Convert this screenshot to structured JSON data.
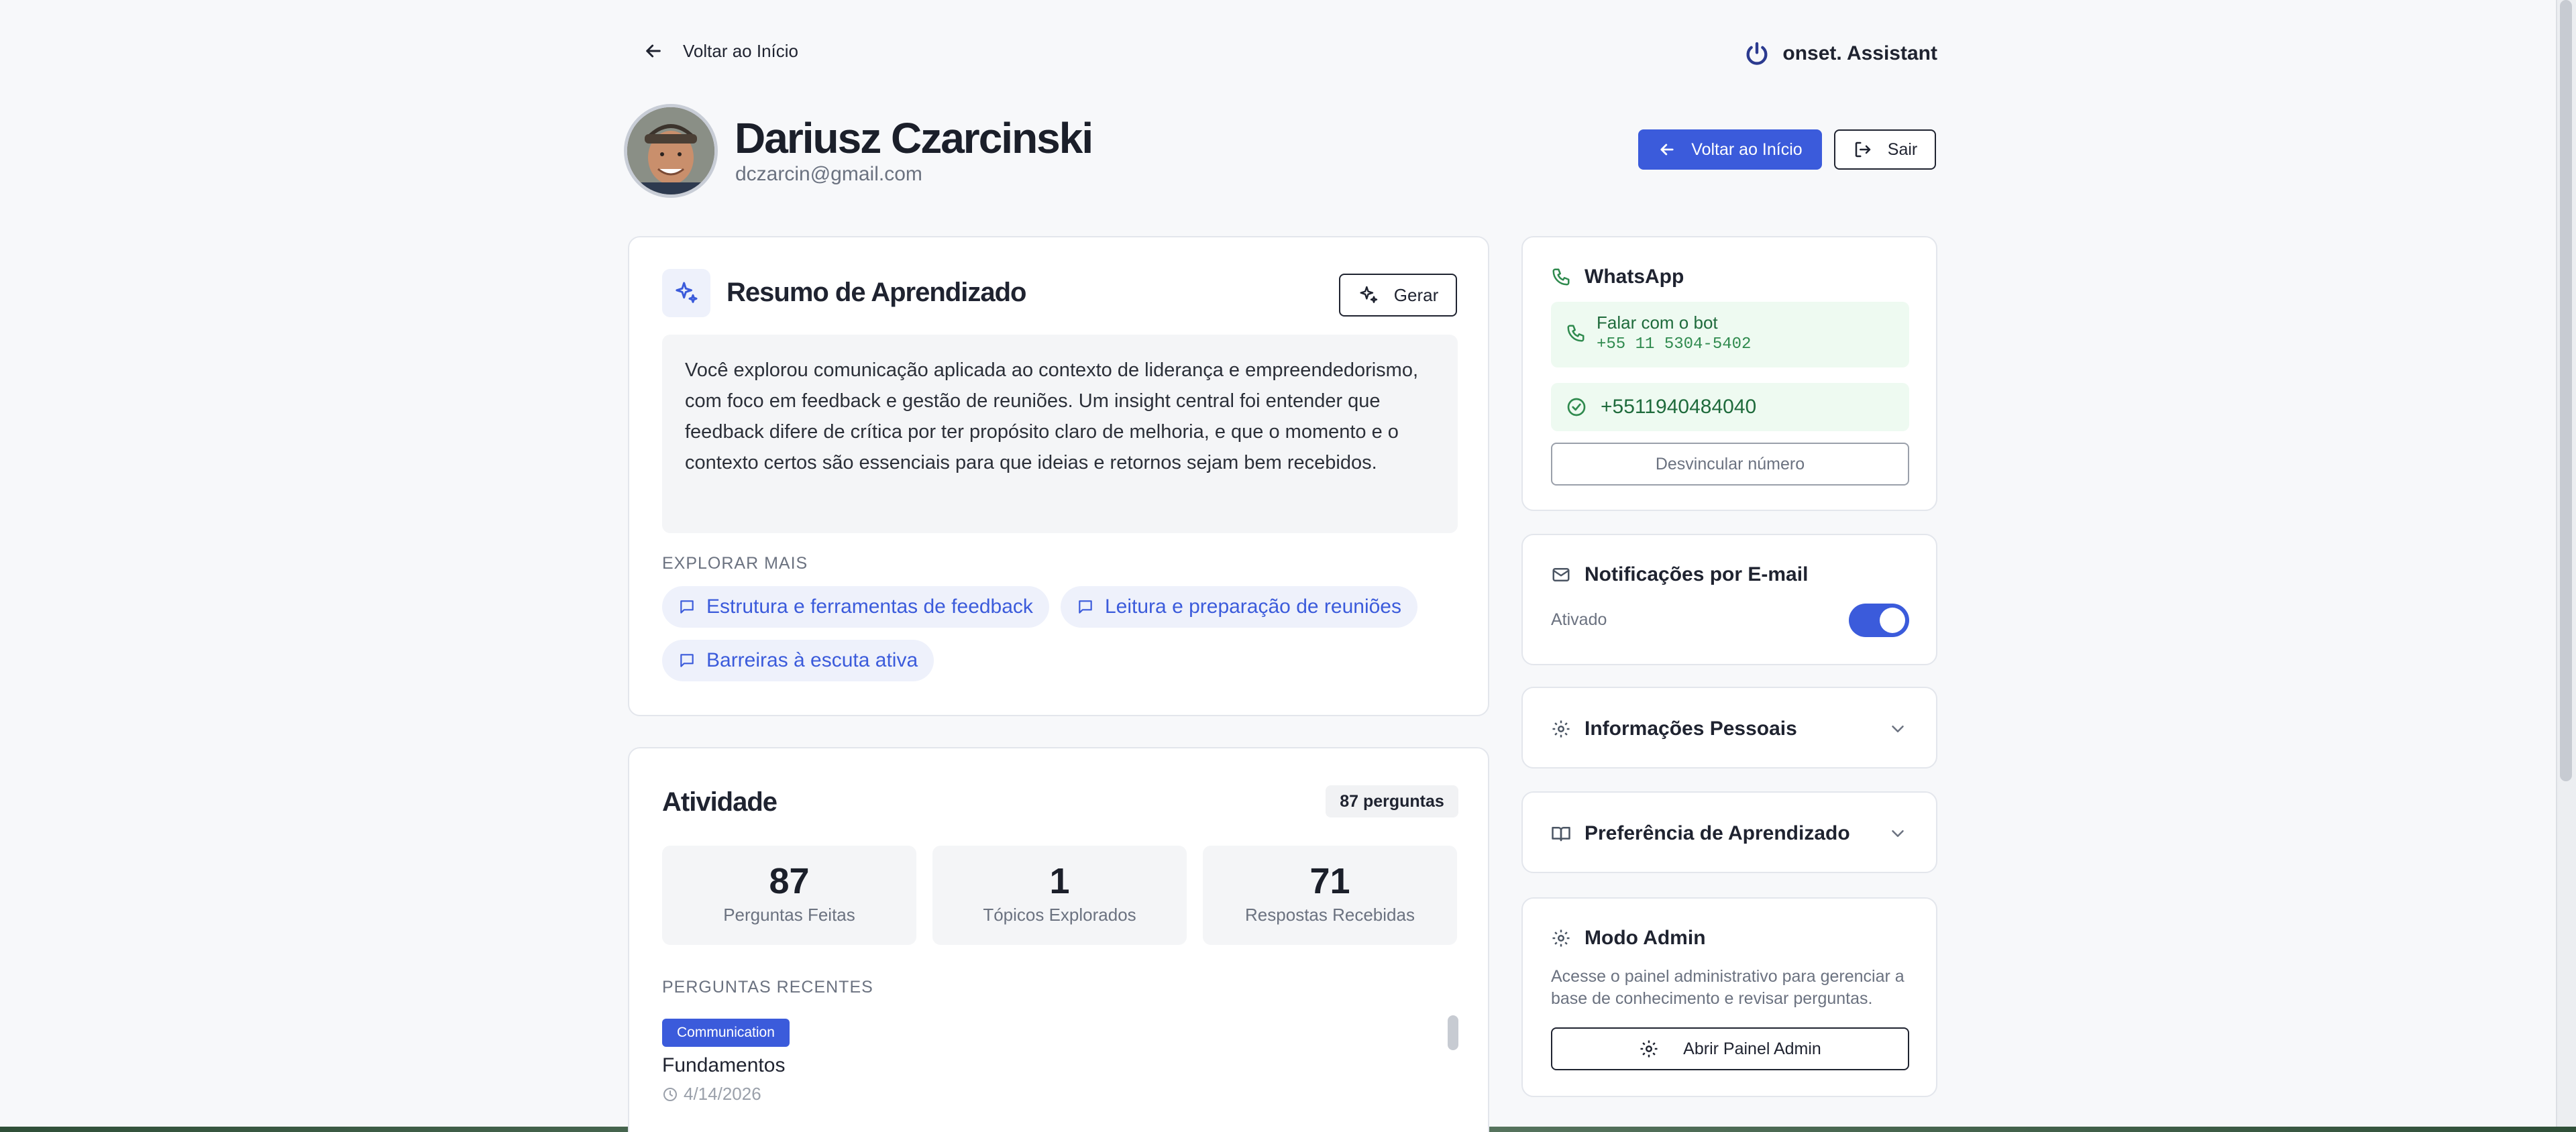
{
  "topbar": {
    "back_label": "Voltar ao Início",
    "brand": "onset. Assistant"
  },
  "profile": {
    "name": "Dariusz Czarcinski",
    "email": "dczarcin@gmail.com",
    "back_button": "Voltar ao Início",
    "logout_button": "Sair"
  },
  "summary": {
    "title": "Resumo de Aprendizado",
    "generate_button": "Gerar",
    "text": "Você explorou comunicação aplicada ao contexto de liderança e empreendedorismo, com foco em feedback e gestão de reuniões. Um insight central foi entender que feedback difere de crítica por ter propósito claro de melhoria, e que o momento e o contexto certos são essenciais para que ideias e retornos sejam bem recebidos.",
    "explore_label": "EXPLORAR MAIS",
    "topics": [
      "Estrutura e ferramentas de feedback",
      "Leitura e preparação de reuniões",
      "Barreiras à escuta ativa"
    ]
  },
  "activity": {
    "title": "Atividade",
    "badge": "87 perguntas",
    "stats": [
      {
        "value": "87",
        "label": "Perguntas Feitas"
      },
      {
        "value": "1",
        "label": "Tópicos Explorados"
      },
      {
        "value": "71",
        "label": "Respostas Recebidas"
      }
    ],
    "recent_label": "PERGUNTAS RECENTES",
    "recent": [
      {
        "tag": "Communication",
        "title": "Fundamentos",
        "date": "4/14/2026"
      }
    ]
  },
  "whatsapp": {
    "title": "WhatsApp",
    "bot_label": "Falar com o bot",
    "bot_number": "+55 11 5304-5402",
    "linked_number": "+5511940484040",
    "unlink_button": "Desvincular número"
  },
  "notifications": {
    "title": "Notificações por E-mail",
    "status": "Ativado",
    "enabled": true
  },
  "personal_info": {
    "title": "Informações Pessoais"
  },
  "learning_pref": {
    "title": "Preferência de Aprendizado"
  },
  "admin": {
    "title": "Modo Admin",
    "description": "Acesse o painel administrativo para gerenciar a base de conhecimento e revisar perguntas.",
    "button": "Abrir Painel Admin"
  },
  "colors": {
    "accent": "#3b5bdb",
    "success_bg": "#eefaf1",
    "success_text": "#1f6b3c"
  }
}
